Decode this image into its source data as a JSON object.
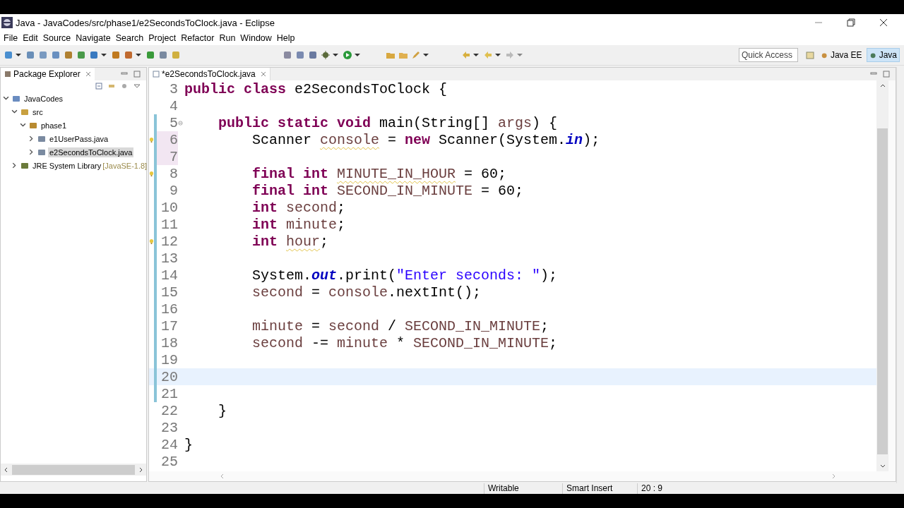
{
  "window": {
    "title": "Java - JavaCodes/src/phase1/e2SecondsToClock.java - Eclipse"
  },
  "menu": [
    "File",
    "Edit",
    "Source",
    "Navigate",
    "Search",
    "Project",
    "Refactor",
    "Run",
    "Window",
    "Help"
  ],
  "quick_access": {
    "placeholder": "Quick Access"
  },
  "perspectives": [
    {
      "label": "Java EE",
      "selected": false
    },
    {
      "label": "Java",
      "selected": true
    }
  ],
  "package_explorer": {
    "title": "Package Explorer",
    "tree": [
      {
        "label": "JavaCodes",
        "kind": "project",
        "expanded": true,
        "selected": false,
        "children": [
          {
            "label": "src",
            "kind": "folder",
            "expanded": true,
            "selected": false,
            "children": [
              {
                "label": "phase1",
                "kind": "package",
                "expanded": true,
                "selected": false,
                "children": [
                  {
                    "label": "e1UserPass.java",
                    "kind": "file",
                    "expanded": false,
                    "selected": false
                  },
                  {
                    "label": "e2SecondsToClock.java",
                    "kind": "file",
                    "expanded": false,
                    "selected": true
                  }
                ]
              }
            ]
          },
          {
            "label": "JRE System Library",
            "decoration": "[JavaSE-1.8]",
            "kind": "library",
            "expanded": false,
            "selected": false
          }
        ]
      }
    ]
  },
  "editor": {
    "tab": {
      "label": "*e2SecondsToClock.java"
    },
    "lines": [
      {
        "number": "3",
        "tokens": [
          {
            "kind": "kw",
            "text": "public "
          },
          {
            "kind": "kw",
            "text": "class "
          },
          {
            "kind": "plain",
            "text": "e2SecondsToClock {"
          }
        ]
      },
      {
        "number": "4"
      },
      {
        "number": "5",
        "fold": true,
        "changed": true,
        "tokens": [
          {
            "kind": "kw",
            "text": "    public "
          },
          {
            "kind": "kw",
            "text": "static "
          },
          {
            "kind": "kw",
            "text": "void "
          },
          {
            "kind": "plain",
            "text": "main(String[] "
          },
          {
            "kind": "var",
            "text": "args"
          },
          {
            "kind": "plain",
            "text": ") {"
          }
        ]
      },
      {
        "number": "6",
        "warning": true,
        "marked": true,
        "changed": true,
        "tokens": [
          {
            "kind": "plain",
            "text": "        Scanner "
          },
          {
            "kind": "var",
            "text": "console",
            "warning": true
          },
          {
            "kind": "plain",
            "text": " = "
          },
          {
            "kind": "kw",
            "text": "new "
          },
          {
            "kind": "plain",
            "text": "Scanner(System."
          },
          {
            "kind": "field",
            "text": "in"
          },
          {
            "kind": "plain",
            "text": ");"
          }
        ]
      },
      {
        "number": "7",
        "marked": true,
        "changed": true
      },
      {
        "number": "8",
        "warning": true,
        "changed": true,
        "tokens": [
          {
            "kind": "kw",
            "text": "        final "
          },
          {
            "kind": "kw",
            "text": "int "
          },
          {
            "kind": "var",
            "text": "MINUTE_IN_HOUR",
            "warning": true
          },
          {
            "kind": "plain",
            "text": " = 60;"
          }
        ]
      },
      {
        "number": "9",
        "changed": true,
        "tokens": [
          {
            "kind": "kw",
            "text": "        final "
          },
          {
            "kind": "kw",
            "text": "int "
          },
          {
            "kind": "var",
            "text": "SECOND_IN_MINUTE"
          },
          {
            "kind": "plain",
            "text": " = 60;"
          }
        ]
      },
      {
        "number": "10",
        "changed": true,
        "tokens": [
          {
            "kind": "kw",
            "text": "        int "
          },
          {
            "kind": "var",
            "text": "second"
          },
          {
            "kind": "plain",
            "text": ";"
          }
        ]
      },
      {
        "number": "11",
        "changed": true,
        "tokens": [
          {
            "kind": "kw",
            "text": "        int "
          },
          {
            "kind": "var",
            "text": "minute"
          },
          {
            "kind": "plain",
            "text": ";"
          }
        ]
      },
      {
        "number": "12",
        "warning": true,
        "changed": true,
        "tokens": [
          {
            "kind": "kw",
            "text": "        int "
          },
          {
            "kind": "var",
            "text": "hour",
            "warning": true
          },
          {
            "kind": "plain",
            "text": ";"
          }
        ]
      },
      {
        "number": "13",
        "changed": true
      },
      {
        "number": "14",
        "changed": true,
        "tokens": [
          {
            "kind": "plain",
            "text": "        System."
          },
          {
            "kind": "field",
            "text": "out"
          },
          {
            "kind": "plain",
            "text": ".print("
          },
          {
            "kind": "str",
            "text": "\"Enter seconds: \""
          },
          {
            "kind": "plain",
            "text": ");"
          }
        ]
      },
      {
        "number": "15",
        "changed": true,
        "tokens": [
          {
            "kind": "var",
            "text": "        second"
          },
          {
            "kind": "plain",
            "text": " = "
          },
          {
            "kind": "var",
            "text": "console"
          },
          {
            "kind": "plain",
            "text": ".nextInt();"
          }
        ]
      },
      {
        "number": "16",
        "changed": true
      },
      {
        "number": "17",
        "changed": true,
        "tokens": [
          {
            "kind": "var",
            "text": "        minute"
          },
          {
            "kind": "plain",
            "text": " = "
          },
          {
            "kind": "var",
            "text": "second"
          },
          {
            "kind": "plain",
            "text": " / "
          },
          {
            "kind": "var",
            "text": "SECOND_IN_MINUTE"
          },
          {
            "kind": "plain",
            "text": ";"
          }
        ]
      },
      {
        "number": "18",
        "changed": true,
        "tokens": [
          {
            "kind": "var",
            "text": "        second"
          },
          {
            "kind": "plain",
            "text": " -= "
          },
          {
            "kind": "var",
            "text": "minute"
          },
          {
            "kind": "plain",
            "text": " * "
          },
          {
            "kind": "var",
            "text": "SECOND_IN_MINUTE"
          },
          {
            "kind": "plain",
            "text": ";"
          }
        ]
      },
      {
        "number": "19",
        "changed": true
      },
      {
        "number": "20",
        "current": true,
        "changed": true
      },
      {
        "number": "21",
        "changed": true
      },
      {
        "number": "22",
        "tokens": [
          {
            "kind": "plain",
            "text": "    }"
          }
        ]
      },
      {
        "number": "23"
      },
      {
        "number": "24",
        "tokens": [
          {
            "kind": "plain",
            "text": "}"
          }
        ]
      },
      {
        "number": "25"
      }
    ]
  },
  "status_bar": [
    "Writable",
    "Smart Insert",
    "20 : 9"
  ]
}
